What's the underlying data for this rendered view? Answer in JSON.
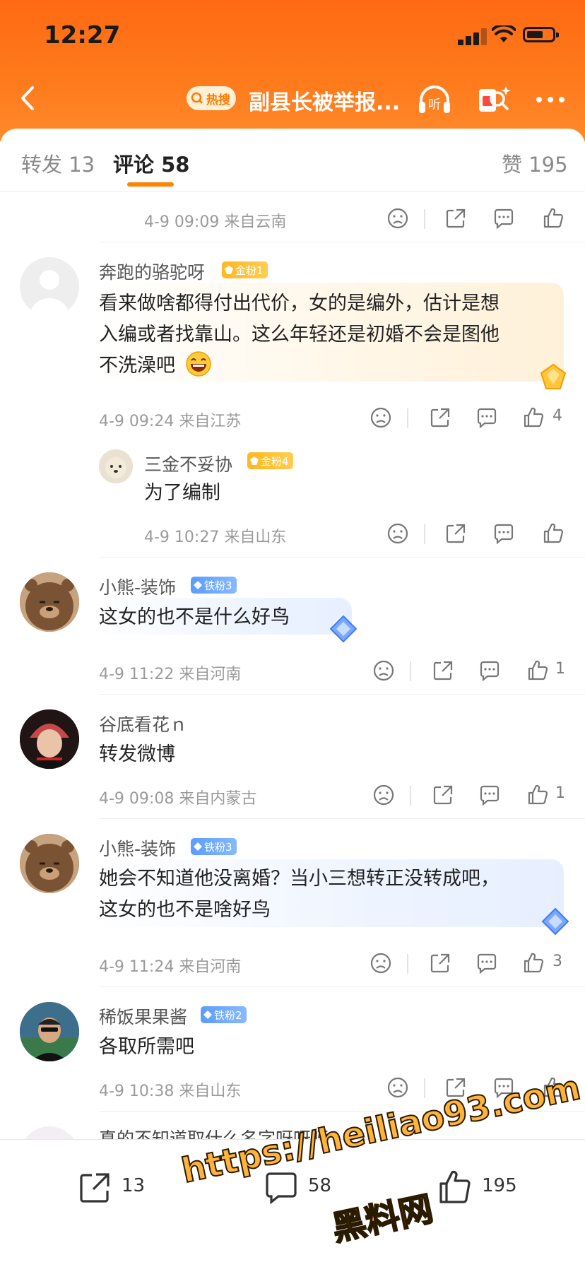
{
  "status": {
    "time": "12:27"
  },
  "nav": {
    "hot_label": "热搜",
    "title": "副县长被举报...",
    "listen_label": "听"
  },
  "tabs": {
    "repost": "转发 13",
    "comments": "评论 58",
    "likes": "赞 195"
  },
  "top_meta": "4-9 09:09  来自云南",
  "comments": [
    {
      "user": "奔跑的骆驼呀",
      "badge": "金粉1",
      "badge_type": "gold",
      "lines": [
        "看来做啥都得付出代价，女的是编外，估计是想",
        "入编或者找靠山。这么年轻还是初婚不会是图他",
        "不洗澡吧"
      ],
      "meta": "4-9 09:24  来自江苏",
      "likes": "4",
      "reply": {
        "user": "三金不妥协",
        "badge": "金粉4",
        "text": "为了编制",
        "meta": "4-9 10:27  来自山东"
      }
    },
    {
      "user": "小熊-装饰",
      "badge": "铁粉3",
      "badge_type": "iron",
      "lines": [
        "这女的也不是什么好鸟"
      ],
      "meta": "4-9 11:22  来自河南",
      "likes": "1"
    },
    {
      "user": "谷底看花ｎ",
      "badge": "",
      "badge_type": "",
      "lines": [
        "转发微博"
      ],
      "meta": "4-9 09:08  来自内蒙古",
      "likes": "1"
    },
    {
      "user": "小熊-装饰",
      "badge": "铁粉3",
      "badge_type": "iron",
      "lines": [
        "她会不知道他没离婚？当小三想转正没转成吧，",
        "这女的也不是啥好鸟"
      ],
      "meta": "4-9 11:24  来自河南",
      "likes": "3"
    },
    {
      "user": "稀饭果果酱",
      "badge": "铁粉2",
      "badge_type": "iron",
      "lines": [
        "各取所需吧"
      ],
      "meta": "4-9 10:38  来自山东",
      "likes": ""
    }
  ],
  "partial_user": "真的不知道取什么名字呀呀呀",
  "bottom": {
    "repost_count": "13",
    "comment_count": "58",
    "like_count": "195"
  },
  "watermark": {
    "line1": "https://heiliao93.com",
    "line2": "黑料网"
  },
  "colors": {
    "header_orange": "#ff6a12",
    "accent": "#ff8200",
    "gold_badge": "#ffb81f",
    "iron_badge": "#5b9cff"
  }
}
